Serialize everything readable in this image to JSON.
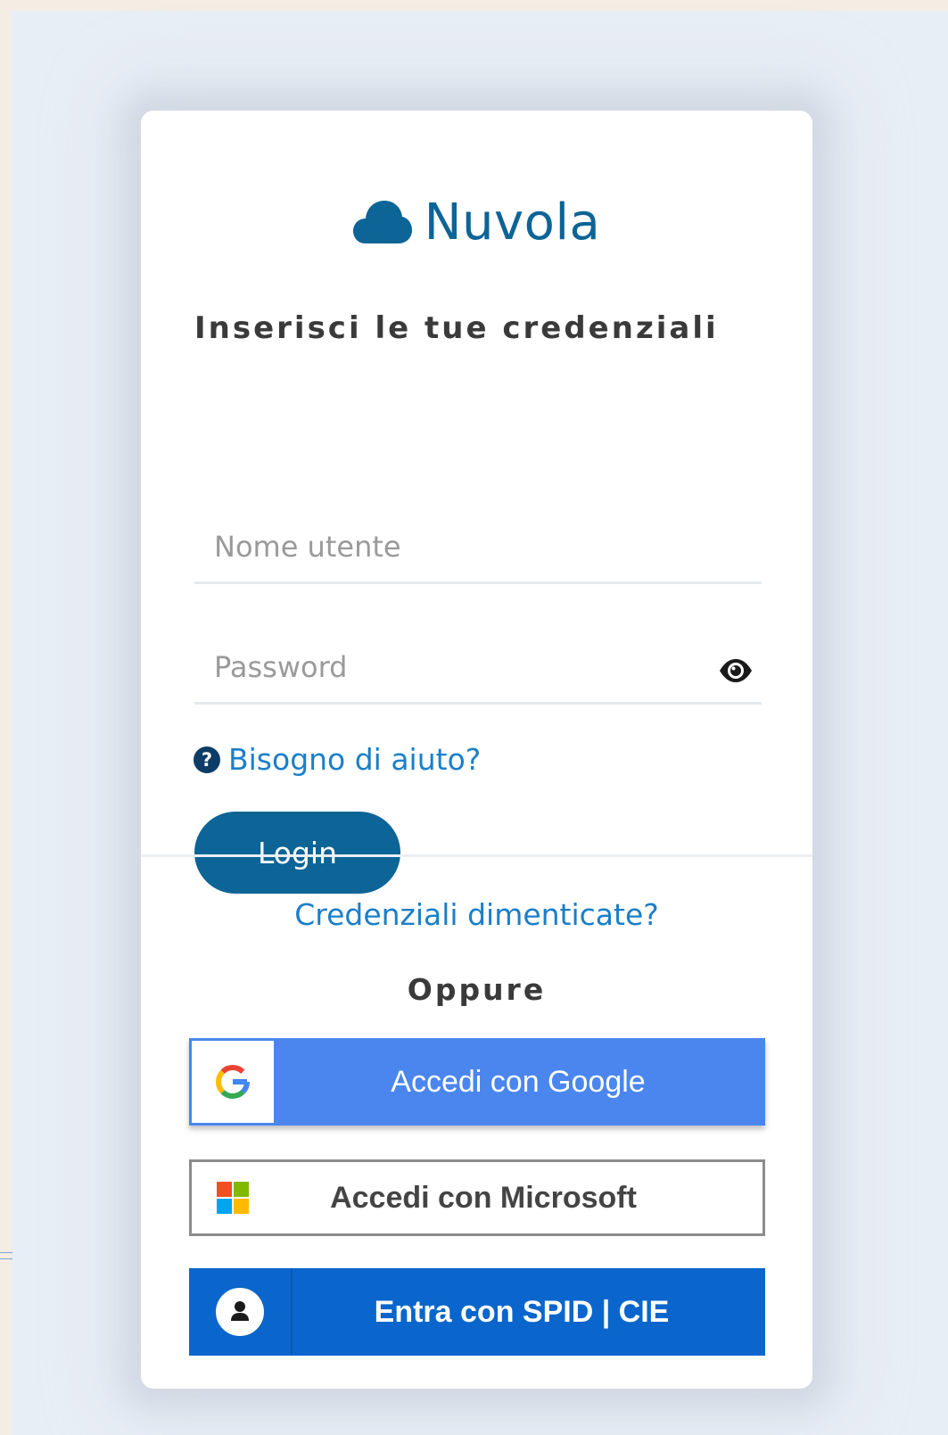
{
  "brand": {
    "name": "Nuvola",
    "icon": "cloud-icon",
    "color": "#0d6496"
  },
  "form": {
    "heading": "Inserisci le tue credenziali",
    "username_placeholder": "Nome utente",
    "username_value": "",
    "password_placeholder": "Password",
    "password_value": "",
    "show_password_icon": "eye-icon",
    "help_icon": "question-circle-icon",
    "help_label": "Bisogno di aiuto?",
    "login_label": "Login"
  },
  "footer": {
    "forgot_label": "Credenziali dimenticate?",
    "or_label": "Oppure"
  },
  "sso": {
    "google_label": "Accedi con Google",
    "google_icon": "google-logo-icon",
    "google_color": "#4a86ee",
    "microsoft_label": "Accedi con Microsoft",
    "microsoft_icon": "microsoft-logo-icon",
    "spid_label": "Entra con SPID | CIE",
    "spid_icon": "user-circle-icon",
    "spid_color": "#0a66cc"
  }
}
